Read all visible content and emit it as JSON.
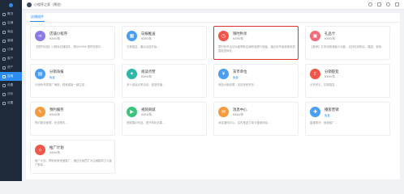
{
  "topbar": {
    "shop_name": "小程序之家（预览）"
  },
  "sidebar": {
    "items": [
      {
        "label": "概况",
        "icon": "home-icon"
      },
      {
        "label": "店铺",
        "icon": "shop-icon"
      },
      {
        "label": "商品",
        "icon": "goods-icon"
      },
      {
        "label": "营销",
        "icon": "marketing-icon"
      },
      {
        "label": "订单",
        "icon": "order-icon"
      },
      {
        "label": "客户",
        "icon": "customer-icon"
      },
      {
        "label": "资产",
        "icon": "asset-icon"
      },
      {
        "label": "应用",
        "icon": "app-icon"
      },
      {
        "label": "设置",
        "icon": "settings-icon"
      },
      {
        "label": "分析",
        "icon": "analysis-icon"
      },
      {
        "label": "设置",
        "icon": "gear-icon"
      }
    ],
    "active_index": 7
  },
  "content": {
    "tab_label": "店铺插件"
  },
  "cards": [
    {
      "title": "店铺小程序",
      "price": "¥399/年",
      "badge": "",
      "desc": "【限时特惠】小程序店铺插件，原价¥1999 限时特惠中…",
      "icon": "link-icon",
      "color": "c-purple",
      "glyph": "∞",
      "highlight": false
    },
    {
      "title": "日报推送",
      "price": "¥399/年",
      "badge": "",
      "desc": "日报推送，最后派送开始…",
      "icon": "calendar-icon",
      "color": "c-blue",
      "glyph": "▦",
      "highlight": false
    },
    {
      "title": "限时秒杀",
      "price": "¥299/年",
      "badge": "",
      "desc": "限时秒杀活动功能帮助店铺快速提升销量，通过秒杀营造紧张氛围促进转化…",
      "icon": "clock-icon",
      "color": "c-red",
      "glyph": "◷",
      "highlight": true
    },
    {
      "title": "礼品卡",
      "price": "¥399/年",
      "badge": "",
      "desc": "【推荐】共享消费储值卡功能，支持在线购买、赠送、使用…",
      "icon": "gift-icon",
      "color": "c-pink",
      "glyph": "▣",
      "highlight": false
    },
    {
      "title": "分销海报",
      "price": "",
      "badge": "免费",
      "desc": "分销商专属推广海报，精美模板一键生成…",
      "icon": "poster-icon",
      "color": "c-blue",
      "glyph": "▤",
      "highlight": false
    },
    {
      "title": "阅读点赞",
      "price": "¥399/年",
      "badge": "",
      "desc": "多人阅读点赞活动，促进传播…",
      "icon": "thumb-icon",
      "color": "c-teal",
      "glyph": "✦",
      "highlight": false
    },
    {
      "title": "货币单位",
      "price": "",
      "badge": "免费",
      "desc": "商品价格设置，支持多种货币…",
      "icon": "yen-icon",
      "color": "c-blue",
      "glyph": "¥",
      "highlight": false
    },
    {
      "title": "分销裂变",
      "price": "¥399/年",
      "badge": "",
      "desc": "分享有礼，拉新裂变…",
      "icon": "share-icon",
      "color": "c-red",
      "glyph": "⇪",
      "highlight": false
    },
    {
      "title": "预约服务",
      "price": "¥399/年",
      "badge": "",
      "desc": "预约服务管理，在线预约…",
      "icon": "reserve-icon",
      "color": "c-orange",
      "glyph": "✎",
      "highlight": false
    },
    {
      "title": "视频商城",
      "price": "¥399/年",
      "badge": "",
      "desc": "视频展示商品，提升转化效果…",
      "icon": "video-icon",
      "color": "c-green",
      "glyph": "▶",
      "highlight": false
    },
    {
      "title": "消息中心",
      "price": "¥399/年",
      "badge": "",
      "desc": "消息通知中心，实时推送订单与营销消息…",
      "icon": "message-icon",
      "color": "c-orange",
      "glyph": "✉",
      "highlight": false
    },
    {
      "title": "播客营销",
      "price": "",
      "badge": "免费",
      "desc": "直播带货，营销推广…",
      "icon": "podcast-icon",
      "color": "c-blue",
      "glyph": "✚",
      "highlight": false
    },
    {
      "title": "推广计划",
      "price": "¥399/年",
      "badge": "",
      "desc": "推广计划，帮助商家快速推广，通过分销员扩大店铺影响力与客户群体…",
      "icon": "promo-icon",
      "color": "c-red",
      "glyph": "⌂",
      "highlight": false
    }
  ]
}
